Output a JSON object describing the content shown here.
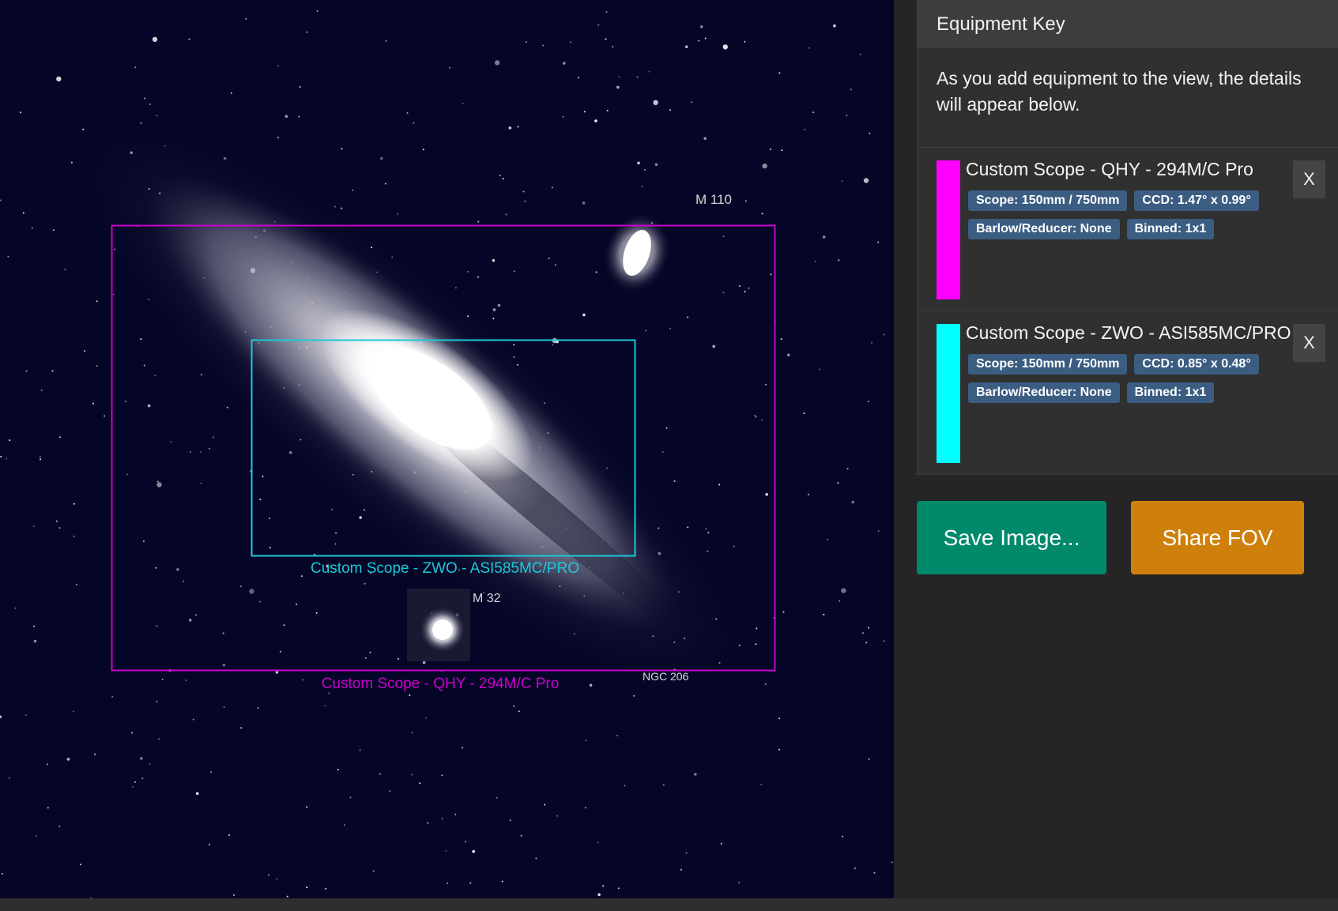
{
  "viewer": {
    "objects": {
      "m110": "M 110",
      "m32": "M 32",
      "ngc206": "NGC 206"
    },
    "fov_labels": {
      "primary": "Custom Scope - QHY - 294M/C Pro",
      "secondary": "Custom Scope - ZWO - ASI585MC/PRO"
    },
    "colors": {
      "sky": "#050627",
      "primary_frame": "#cc00cc",
      "secondary_frame": "#1ec8d8"
    }
  },
  "equipment_key": {
    "title": "Equipment Key",
    "intro": "As you add equipment to the view, the details will appear below.",
    "items": [
      {
        "name": "Custom Scope - QHY - 294M/C Pro",
        "color": "#ff00ff",
        "badges": [
          "Scope: 150mm / 750mm",
          "CCD: 1.47° x 0.99°",
          "Barlow/Reducer: None",
          "Binned: 1x1"
        ],
        "remove_label": "X"
      },
      {
        "name": "Custom Scope - ZWO - ASI585MC/PRO",
        "color": "#00ffff",
        "badges": [
          "Scope: 150mm / 750mm",
          "CCD: 0.85° x 0.48°",
          "Barlow/Reducer: None",
          "Binned: 1x1"
        ],
        "remove_label": "X"
      }
    ]
  },
  "actions": {
    "save_label": "Save Image...",
    "save_color": "#00896b",
    "share_label": "Share FOV",
    "share_color": "#cf800c"
  }
}
